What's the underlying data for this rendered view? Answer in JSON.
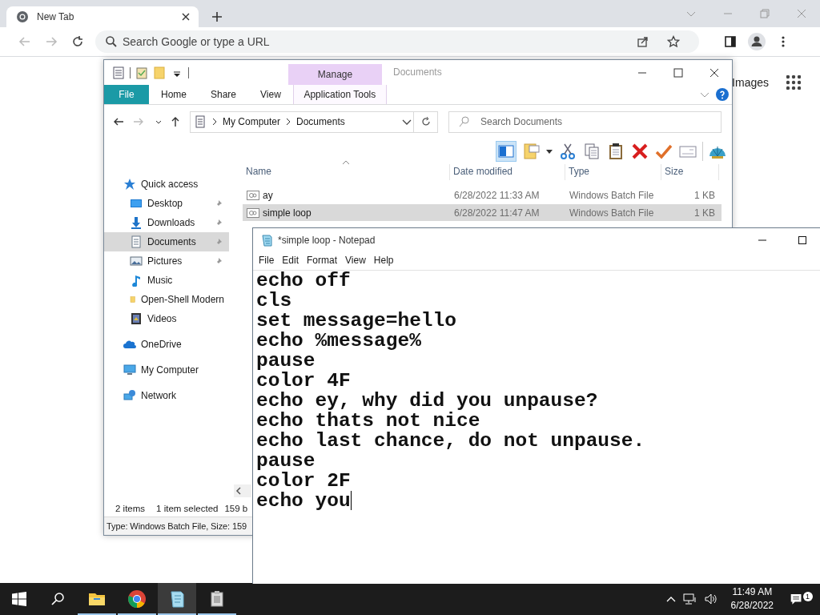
{
  "browser": {
    "tabs": [
      {
        "title": "New Tab",
        "selected": true
      }
    ],
    "omnibox": {
      "placeholder": "Search Google or type a URL"
    },
    "page_links": [
      {
        "label": "Images"
      }
    ]
  },
  "explorer": {
    "title": "Documents",
    "context_group": "Manage",
    "ribbon_tabs": [
      {
        "label": "File",
        "kind": "file",
        "selected": false
      },
      {
        "label": "Home",
        "kind": "plain",
        "selected": false
      },
      {
        "label": "Share",
        "kind": "plain",
        "selected": false
      },
      {
        "label": "View",
        "kind": "plain",
        "selected": false
      },
      {
        "label": "Application Tools",
        "kind": "contextual",
        "selected": false
      }
    ],
    "breadcrumb": [
      "My Computer",
      "Documents"
    ],
    "search": {
      "placeholder": "Search Documents"
    },
    "nav": [
      {
        "label": "Quick access",
        "kind": "quick",
        "selected": false,
        "children": [
          {
            "label": "Desktop",
            "kind": "desktop",
            "pinned": true,
            "selected": false
          },
          {
            "label": "Downloads",
            "kind": "downloads",
            "pinned": true,
            "selected": false
          },
          {
            "label": "Documents",
            "kind": "documents",
            "pinned": true,
            "selected": true
          },
          {
            "label": "Pictures",
            "kind": "pictures",
            "pinned": true,
            "selected": false
          },
          {
            "label": "Music",
            "kind": "music",
            "pinned": false,
            "selected": false
          },
          {
            "label": "Open-Shell Modern",
            "kind": "folder",
            "pinned": false,
            "selected": false
          },
          {
            "label": "Videos",
            "kind": "videos",
            "pinned": false,
            "selected": false
          }
        ]
      },
      {
        "label": "OneDrive",
        "kind": "onedrive",
        "selected": false
      },
      {
        "label": "My Computer",
        "kind": "computer",
        "selected": false
      },
      {
        "label": "Network",
        "kind": "network",
        "selected": false
      }
    ],
    "columns": [
      "Name",
      "Date modified",
      "Type",
      "Size"
    ],
    "files": [
      {
        "name": "ay",
        "date": "6/28/2022 11:33 AM",
        "type": "Windows Batch File",
        "size": "1 KB",
        "selected": false
      },
      {
        "name": "simple loop",
        "date": "6/28/2022 11:47 AM",
        "type": "Windows Batch File",
        "size": "1 KB",
        "selected": true
      }
    ],
    "status": {
      "count": "2 items",
      "selection": "1 item selected",
      "size": "159 b"
    },
    "details": "Type: Windows Batch File, Size: 159"
  },
  "notepad": {
    "title": "*simple loop - Notepad",
    "menu": [
      "File",
      "Edit",
      "Format",
      "View",
      "Help"
    ],
    "lines": [
      "echo off",
      "cls",
      "set message=hello",
      "echo %message%",
      "pause",
      "color 4F",
      "echo ey, why did you unpause?",
      "echo thats not nice",
      "echo last chance, do not unpause.",
      "pause",
      "color 2F",
      "echo you"
    ]
  },
  "taskbar": {
    "apps": [
      {
        "kind": "explorer",
        "selected": false
      },
      {
        "kind": "chrome",
        "selected": false
      },
      {
        "kind": "notepad",
        "selected": true
      },
      {
        "kind": "installer",
        "selected": false
      }
    ],
    "time": "11:49 AM",
    "date": "6/28/2022",
    "notifications": "1"
  }
}
